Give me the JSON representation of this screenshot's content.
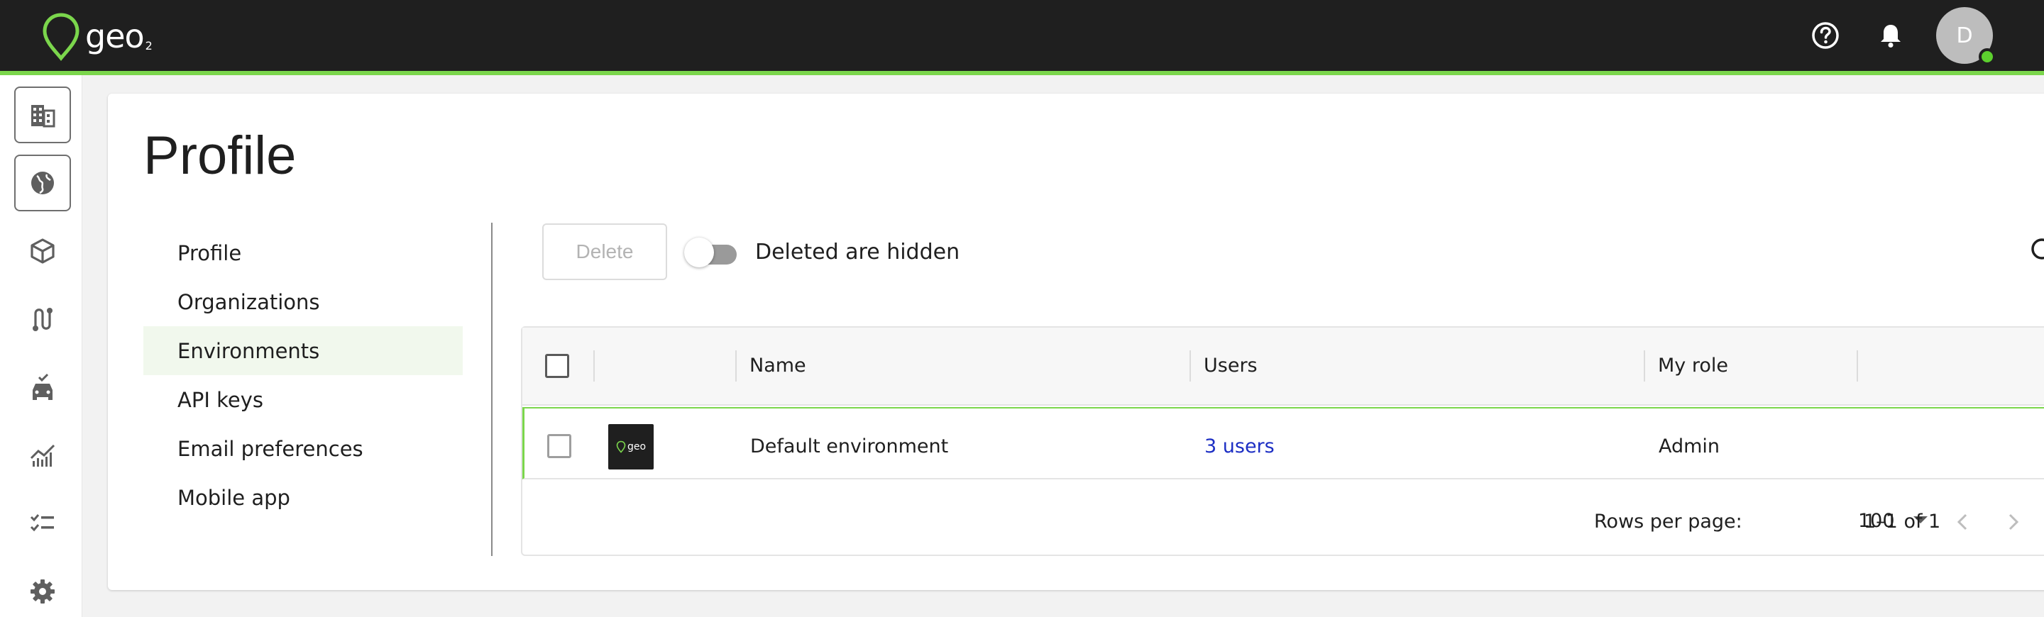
{
  "app": {
    "brand": "geo",
    "brand_sub": "2",
    "user_initial": "D",
    "accent_color": "#7bd64c",
    "topbar_color": "#1f1f1f",
    "link_color": "#1d2fc4"
  },
  "header_icons": [
    "help-icon",
    "bell-icon"
  ],
  "rail": {
    "items": [
      "buildings-icon",
      "globe-icon",
      "box-icon",
      "route-icon",
      "vehicle-icon",
      "analytics-icon",
      "checklist-icon",
      "gear-icon"
    ]
  },
  "page": {
    "title": "Profile"
  },
  "subnav": {
    "items": [
      {
        "label": "Profile"
      },
      {
        "label": "Organizations"
      },
      {
        "label": "Environments",
        "active": true
      },
      {
        "label": "API keys"
      },
      {
        "label": "Email preferences"
      },
      {
        "label": "Mobile app"
      }
    ]
  },
  "toolbar": {
    "delete_label": "Delete",
    "toggle_label": "Deleted are hidden",
    "toggle_on": false
  },
  "table": {
    "columns": [
      "Name",
      "Users",
      "My role"
    ],
    "rows": [
      {
        "thumb_text": "geo",
        "name": "Default environment",
        "users": "3 users",
        "role": "Admin"
      }
    ],
    "rows_per_page_label": "Rows per page:",
    "rows_per_page_value": "100",
    "range_label": "1–1 of 1"
  }
}
